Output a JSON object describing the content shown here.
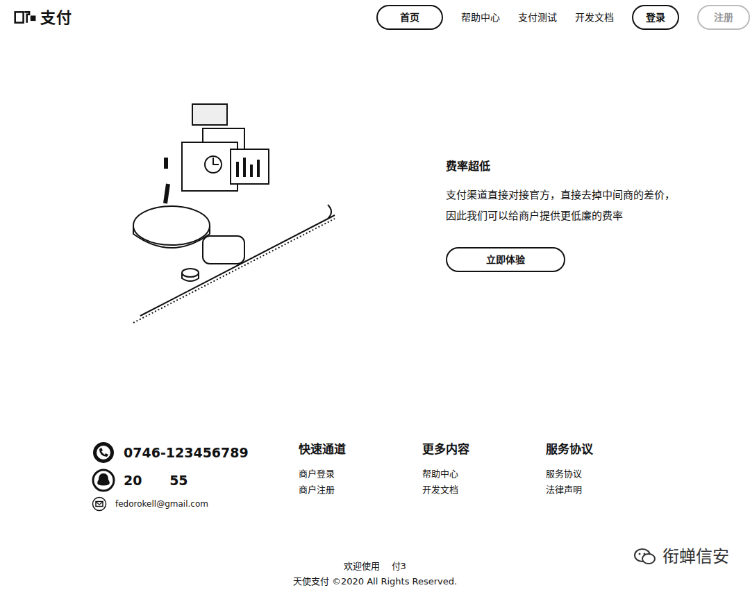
{
  "logo": {
    "text": "支付"
  },
  "nav": [
    {
      "label": "首页",
      "kind": "pill"
    },
    {
      "label": "帮助中心",
      "kind": "link"
    },
    {
      "label": "支付测试",
      "kind": "link"
    },
    {
      "label": "开发文档",
      "kind": "link"
    },
    {
      "label": "登录",
      "kind": "pill"
    },
    {
      "label": "注册",
      "kind": "pill-light"
    }
  ],
  "hero": {
    "title": "费率超低",
    "description": "支付渠道直接对接官方，直接去掉中间商的差价，因此我们可以给商户提供更低廉的费率",
    "button": "立即体验"
  },
  "contacts": [
    {
      "kind": "phone",
      "text": "0746-123456789"
    },
    {
      "kind": "qq",
      "text": "20      55"
    },
    {
      "kind": "email",
      "text": "fedorokell@gmail.com"
    }
  ],
  "footer_columns": [
    {
      "title": "快速通道",
      "links": [
        "商户登录",
        "商户注册"
      ]
    },
    {
      "title": "更多内容",
      "links": [
        "帮助中心",
        "开发文档"
      ]
    },
    {
      "title": "服务协议",
      "links": [
        "服务协议",
        "法律声明"
      ]
    }
  ],
  "bottom": {
    "welcome": "欢迎使用    付3",
    "copyright": "天使支付 ©2020 All Rights Reserved."
  },
  "watermark": {
    "text": "衔蝉信安"
  }
}
